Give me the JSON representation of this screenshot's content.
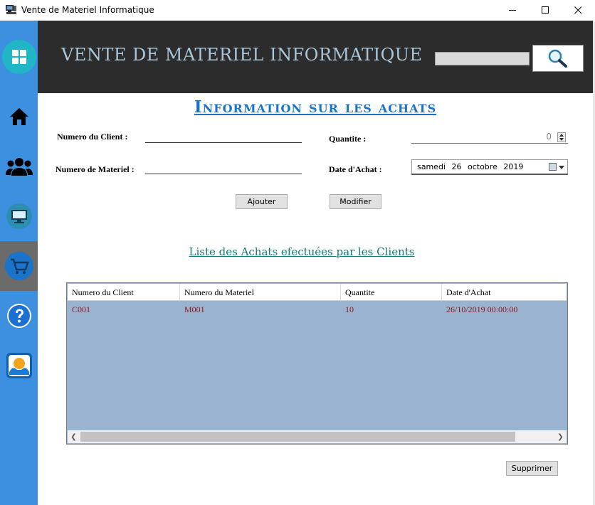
{
  "window": {
    "title": "Vente de Materiel Informatique",
    "controls": [
      "minimize",
      "maximize",
      "close"
    ]
  },
  "sidebar": {
    "items": [
      {
        "name": "dashboard",
        "icon": "grid-icon"
      },
      {
        "name": "home",
        "icon": "home-icon"
      },
      {
        "name": "clients",
        "icon": "users-icon"
      },
      {
        "name": "materiel",
        "icon": "monitor-icon"
      },
      {
        "name": "achats",
        "icon": "cart-icon",
        "active": true
      },
      {
        "name": "help",
        "icon": "help-icon"
      },
      {
        "name": "about",
        "icon": "info-hands-icon"
      }
    ]
  },
  "header": {
    "title": "VENTE DE MATERIEL INFORMATIQUE",
    "search_value": ""
  },
  "form": {
    "title": "Information sur les achats",
    "client_label": "Numero du Client :",
    "client_value": "",
    "materiel_label": "Numero de Materiel  :",
    "materiel_value": "",
    "quantite_label": "Quantite  :",
    "quantite_value": "0",
    "date_label": "Date d'Achat  :",
    "date_value": "samedi 26 octobre 2019",
    "add_label": "Ajouter",
    "modify_label": "Modifier"
  },
  "list": {
    "title": "Liste des Achats efectuées par les Clients",
    "columns": [
      "Numero du Client",
      "Numero du Materiel",
      "Quantite",
      "Date d'Achat"
    ],
    "rows": [
      [
        "C001",
        "M001",
        "10",
        "26/10/2019 00:00:00"
      ]
    ]
  },
  "delete_label": "Supprimer",
  "colors": {
    "sidebar": "#3d8fe0",
    "header": "#2c2c2c",
    "section_title": "#1a73c9",
    "list_title": "#14797a",
    "grid_background": "#9ab3d1",
    "row_text": "#8b1a1a"
  }
}
